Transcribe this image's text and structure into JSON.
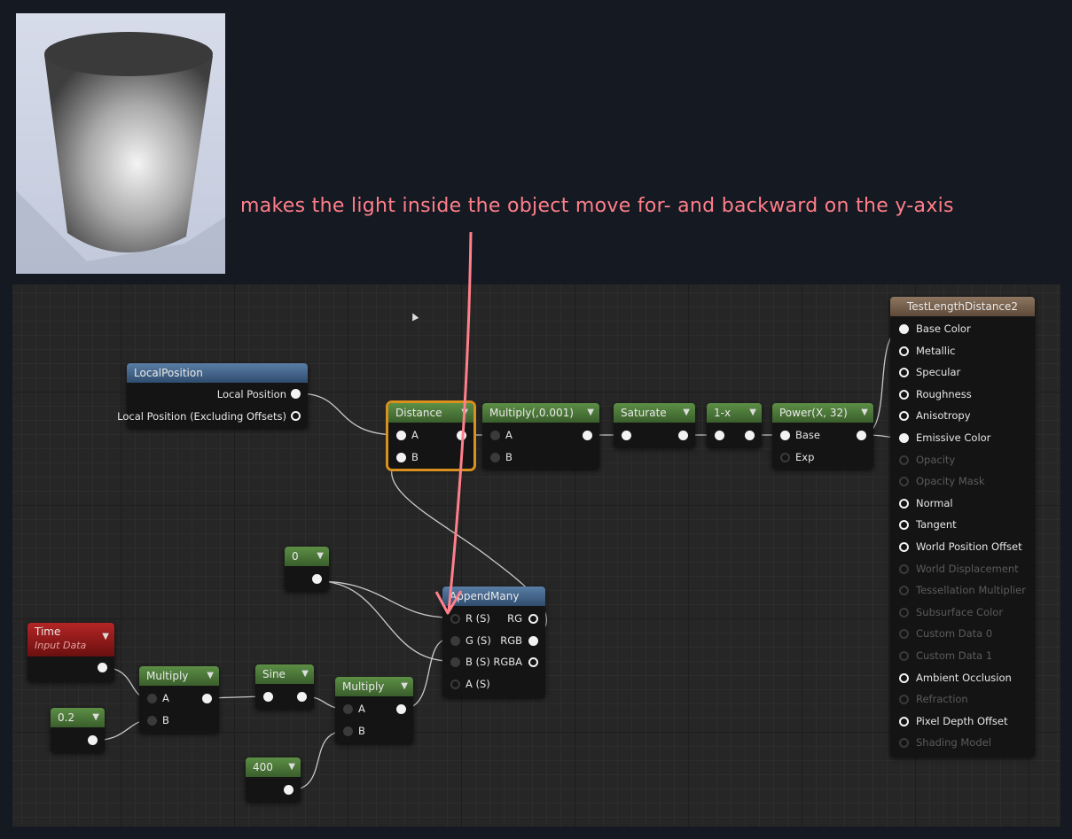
{
  "annotation": "makes the light inside the object move for- and backward on the y-axis",
  "nodes": {
    "local_position": {
      "title": "LocalPosition",
      "out1": "Local Position",
      "out2": "Local Position (Excluding Offsets)"
    },
    "distance": {
      "title": "Distance",
      "a": "A",
      "b": "B"
    },
    "multiply1": {
      "title": "Multiply(,0.001)",
      "a": "A",
      "b": "B"
    },
    "saturate": {
      "title": "Saturate"
    },
    "oneminus": {
      "title": "1-x"
    },
    "power": {
      "title": "Power(X, 32)",
      "base": "Base",
      "exp": "Exp"
    },
    "const0": {
      "title": "0"
    },
    "append": {
      "title": "AppendMany",
      "r": "R (S)",
      "g": "G (S)",
      "b": "B (S)",
      "a": "A (S)",
      "rg": "RG",
      "rgb": "RGB",
      "rgba": "RGBA"
    },
    "time": {
      "title": "Time",
      "subtitle": "Input Data"
    },
    "const02": {
      "title": "0.2"
    },
    "multiply2": {
      "title": "Multiply",
      "a": "A",
      "b": "B"
    },
    "sine": {
      "title": "Sine"
    },
    "multiply3": {
      "title": "Multiply",
      "a": "A",
      "b": "B"
    },
    "const400": {
      "title": "400"
    }
  },
  "material": {
    "title": "TestLengthDistance2",
    "inputs": [
      {
        "label": "Base Color",
        "state": "filled"
      },
      {
        "label": "Metallic",
        "state": "hollow"
      },
      {
        "label": "Specular",
        "state": "hollow"
      },
      {
        "label": "Roughness",
        "state": "hollow"
      },
      {
        "label": "Anisotropy",
        "state": "hollow"
      },
      {
        "label": "Emissive Color",
        "state": "filled"
      },
      {
        "label": "Opacity",
        "state": "disabled"
      },
      {
        "label": "Opacity Mask",
        "state": "disabled"
      },
      {
        "label": "Normal",
        "state": "hollow"
      },
      {
        "label": "Tangent",
        "state": "hollow"
      },
      {
        "label": "World Position Offset",
        "state": "hollow"
      },
      {
        "label": "World Displacement",
        "state": "disabled"
      },
      {
        "label": "Tessellation Multiplier",
        "state": "disabled"
      },
      {
        "label": "Subsurface Color",
        "state": "disabled"
      },
      {
        "label": "Custom Data 0",
        "state": "disabled"
      },
      {
        "label": "Custom Data 1",
        "state": "disabled"
      },
      {
        "label": "Ambient Occlusion",
        "state": "hollow"
      },
      {
        "label": "Refraction",
        "state": "disabled"
      },
      {
        "label": "Pixel Depth Offset",
        "state": "hollow"
      },
      {
        "label": "Shading Model",
        "state": "disabled"
      }
    ]
  }
}
